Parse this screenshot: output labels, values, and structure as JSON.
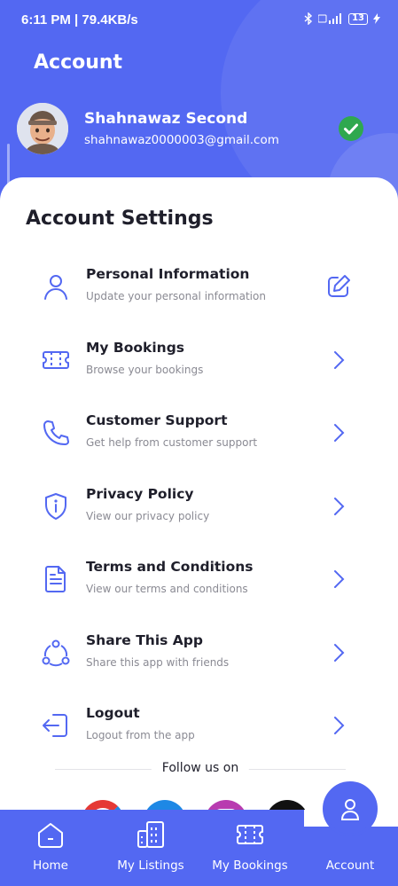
{
  "status_bar": {
    "time_speed": "6:11 PM | 79.4KB/s",
    "battery": "13"
  },
  "header": {
    "title": "Account"
  },
  "profile": {
    "name": "Shahnawaz Second",
    "email": "shahnawaz0000003@gmail.com",
    "verified_icon": "check-circle-icon"
  },
  "settings": {
    "title": "Account Settings",
    "items": [
      {
        "title": "Personal Information",
        "subtitle": "Update your personal information",
        "icon": "user-icon",
        "action": "edit-icon"
      },
      {
        "title": "My Bookings",
        "subtitle": "Browse your bookings",
        "icon": "ticket-icon",
        "action": "chevron-right-icon"
      },
      {
        "title": "Customer Support",
        "subtitle": "Get help from customer support",
        "icon": "phone-icon",
        "action": "chevron-right-icon"
      },
      {
        "title": "Privacy Policy",
        "subtitle": "View our privacy policy",
        "icon": "shield-info-icon",
        "action": "chevron-right-icon"
      },
      {
        "title": "Terms and Conditions",
        "subtitle": "View our terms and conditions",
        "icon": "document-icon",
        "action": "chevron-right-icon"
      },
      {
        "title": "Share This App",
        "subtitle": "Share this app with friends",
        "icon": "share-icon",
        "action": "chevron-right-icon"
      },
      {
        "title": "Logout",
        "subtitle": "Logout from the app",
        "icon": "logout-icon",
        "action": "chevron-right-icon"
      }
    ]
  },
  "follow": {
    "label": "Follow us on",
    "socials": [
      "google-icon",
      "facebook-icon",
      "instagram-icon",
      "x-icon"
    ]
  },
  "bottom_nav": {
    "items": [
      {
        "label": "Home",
        "icon": "home-icon"
      },
      {
        "label": "My Listings",
        "icon": "buildings-icon"
      },
      {
        "label": "My Bookings",
        "icon": "ticket-icon"
      },
      {
        "label": "Account",
        "icon": "user-icon"
      }
    ],
    "active": "Account"
  },
  "colors": {
    "primary": "#5368f2",
    "verified": "#2fa84f",
    "text": "#1f1f2b",
    "muted": "#8a8a93"
  }
}
